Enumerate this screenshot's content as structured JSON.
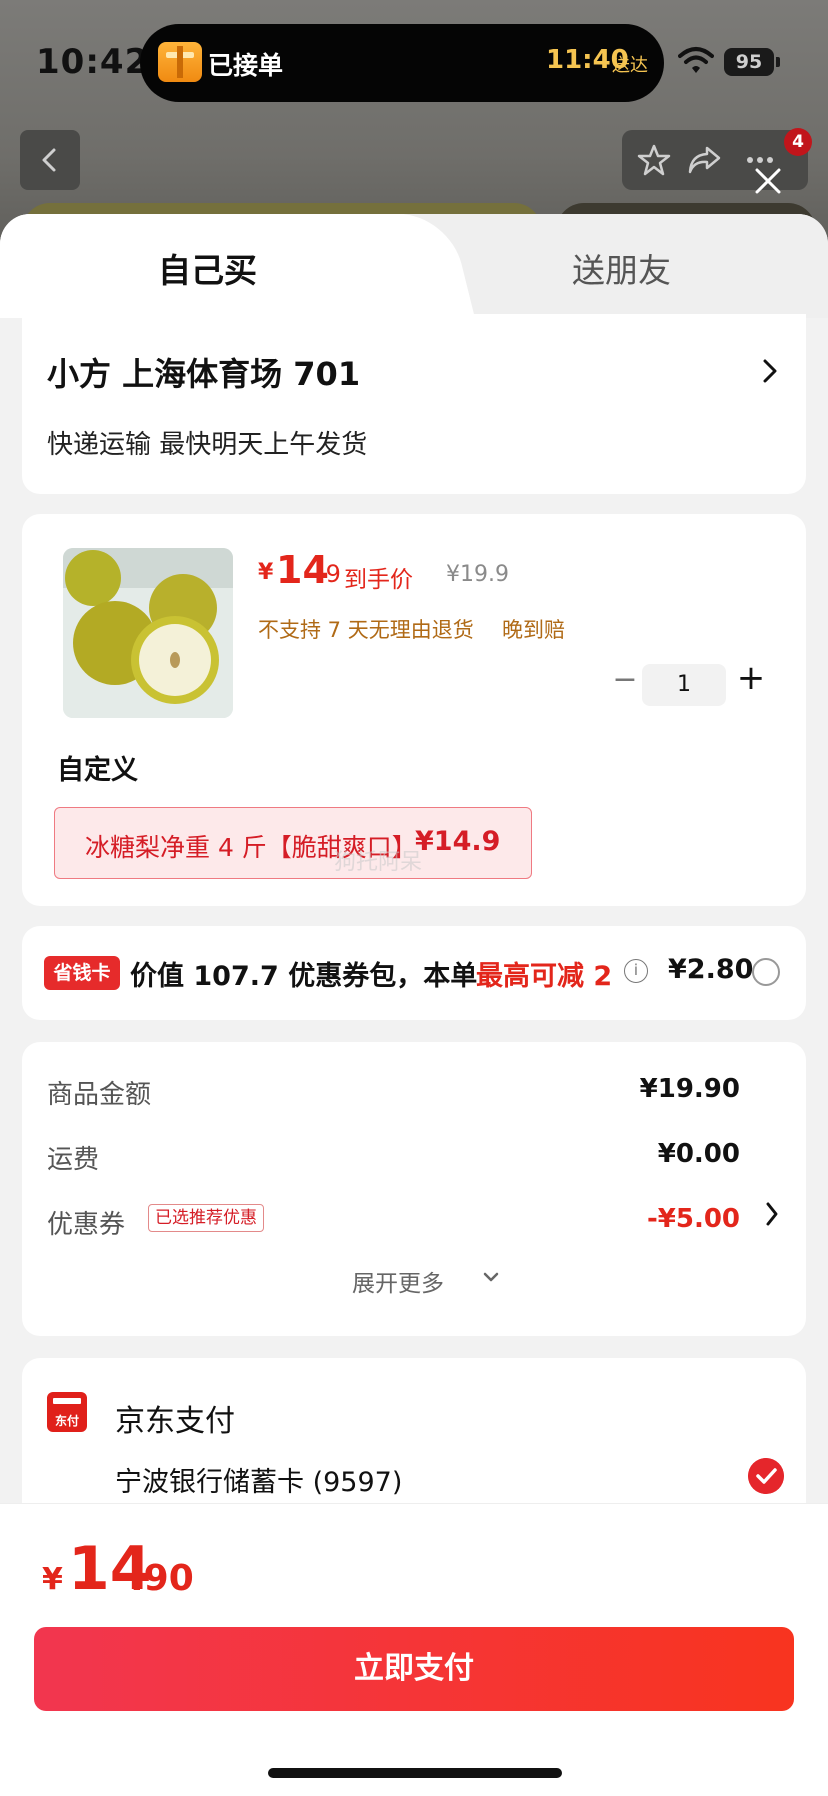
{
  "status_bar": {
    "time": "10:42",
    "live_activity_text": "已接单",
    "eta_time": "11:40",
    "eta_suffix": "送达",
    "battery": "95"
  },
  "nav": {
    "badge_count": "4"
  },
  "tabs": [
    {
      "label": "自己买",
      "active": true
    },
    {
      "label": "送朋友",
      "active": false
    }
  ],
  "address": {
    "name_line": "小方  上海体育场 701",
    "shipping": "快递运输 最快明天上午发货"
  },
  "product": {
    "price_symbol": "¥",
    "price_int": "14",
    "price_dec": ".9",
    "price_tag": "到手价",
    "original_price": "¥19.9",
    "note_return": "不支持 7 天无理由退货",
    "note_late": "晚到赔",
    "quantity": "1",
    "qty_minus": "−",
    "qty_plus": "+",
    "custom_title": "自定义",
    "sku_label": "冰糖梨净重 4 斤【脆甜爽口】",
    "sku_price": "¥14.9",
    "watermark": "狗托阿呆"
  },
  "coupon_pack": {
    "tag": "省钱卡",
    "text": "价值 107.7 优惠券包，本单",
    "highlight": "最高可减 2",
    "info": "i",
    "price": "¥2.80"
  },
  "summary": {
    "rows": [
      {
        "label": "商品金额",
        "value": "¥19.90"
      },
      {
        "label": "运费",
        "value": "¥0.00"
      },
      {
        "label": "优惠券",
        "value": "-¥5.00",
        "badge": "已选推荐优惠"
      }
    ],
    "expand_label": "展开更多"
  },
  "payment": {
    "logo_text": "东付",
    "title": "京东支付",
    "card": "宁波银行储蓄卡 (9597)"
  },
  "footer": {
    "total_symbol": "¥",
    "total_int": "14",
    "total_dec": ".90",
    "pay_button": "立即支付"
  },
  "colors": {
    "accent_red": "#e3261b",
    "button_gradient_start": "#f2364f",
    "button_gradient_end": "#f8341f",
    "eta_gold": "#f5c451"
  }
}
